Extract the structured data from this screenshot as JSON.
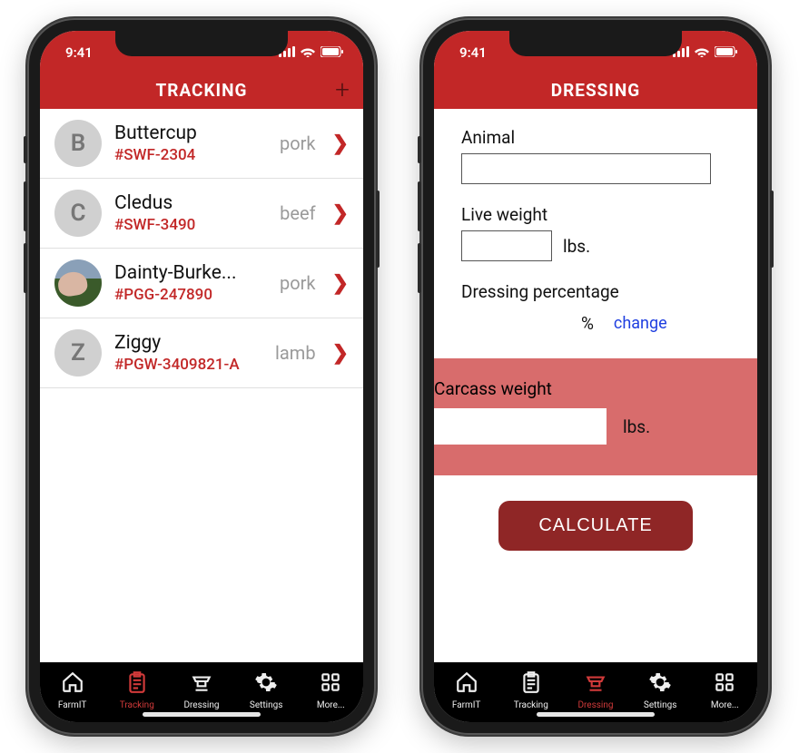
{
  "status": {
    "time": "9:41"
  },
  "left": {
    "title": "TRACKING",
    "items": [
      {
        "initial": "B",
        "name": "Buttercup",
        "id": "#SWF-2304",
        "type": "pork",
        "photo": false
      },
      {
        "initial": "C",
        "name": "Cledus",
        "id": "#SWF-3490",
        "type": "beef",
        "photo": false
      },
      {
        "initial": "",
        "name": "Dainty-Burke...",
        "id": "#PGG-247890",
        "type": "pork",
        "photo": true
      },
      {
        "initial": "Z",
        "name": "Ziggy",
        "id": "#PGW-3409821-A",
        "type": "lamb",
        "photo": false
      }
    ]
  },
  "right": {
    "title": "DRESSING",
    "labels": {
      "animal": "Animal",
      "live_weight": "Live weight",
      "dressing_pct": "Dressing percentage",
      "carcass": "Carcass weight",
      "unit_lbs": "lbs.",
      "unit_pct": "%",
      "change": "change",
      "calculate": "CALCULATE"
    },
    "values": {
      "animal": "",
      "live_weight": "",
      "dressing_pct": "",
      "carcass": ""
    }
  },
  "tabs": [
    {
      "key": "farmit",
      "label": "FarmIT"
    },
    {
      "key": "tracking",
      "label": "Tracking"
    },
    {
      "key": "dressing",
      "label": "Dressing"
    },
    {
      "key": "settings",
      "label": "Settings"
    },
    {
      "key": "more",
      "label": "More..."
    }
  ]
}
